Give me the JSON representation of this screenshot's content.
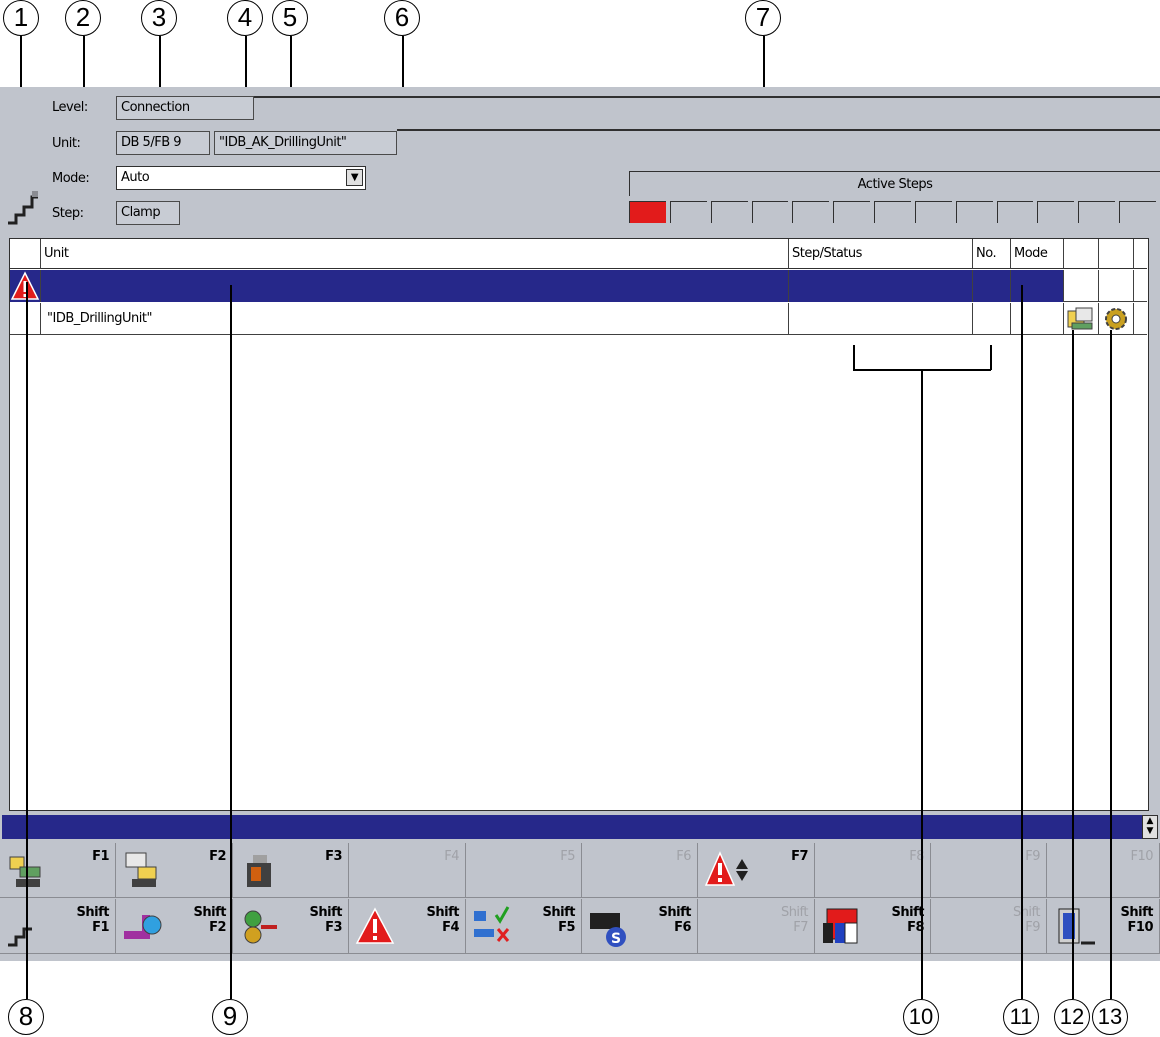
{
  "callouts": [
    "1",
    "2",
    "3",
    "4",
    "5",
    "6",
    "7",
    "8",
    "9",
    "10",
    "11",
    "12",
    "13"
  ],
  "header": {
    "level_label": "Level:",
    "level_value": "Connection",
    "unit_label": "Unit:",
    "unit_db": "DB 5/FB 9",
    "unit_name": "\"IDB_AK_DrillingUnit\"",
    "mode_label": "Mode:",
    "mode_value": "Auto",
    "step_label": "Step:",
    "step_value": "Clamp",
    "active_steps_label": "Active Steps",
    "active_steps_total": 13,
    "active_steps_active": [
      1
    ]
  },
  "table": {
    "columns": [
      "Unit",
      "Step/Status",
      "No.",
      "Mode"
    ],
    "rows": [
      {
        "unit": "",
        "step_status": "",
        "no": "",
        "mode": "",
        "selected": true,
        "alarm": true
      },
      {
        "unit": "\"IDB_DrillingUnit\"",
        "step_status": "",
        "no": "",
        "mode": "",
        "selected": false,
        "alarm": false
      }
    ]
  },
  "fkeys_row1": [
    {
      "label": "F1",
      "icon": "overview-icon",
      "enabled": true
    },
    {
      "label": "F2",
      "icon": "unit-view-icon",
      "enabled": true
    },
    {
      "label": "F3",
      "icon": "step-view-icon",
      "enabled": true
    },
    {
      "label": "F4",
      "icon": "",
      "enabled": false
    },
    {
      "label": "F5",
      "icon": "",
      "enabled": false
    },
    {
      "label": "F6",
      "icon": "",
      "enabled": false
    },
    {
      "label": "F7",
      "icon": "alarm-navigation-icon",
      "enabled": true
    },
    {
      "label": "F8",
      "icon": "",
      "enabled": false
    },
    {
      "label": "F9",
      "icon": "",
      "enabled": false
    },
    {
      "label": "F10",
      "icon": "",
      "enabled": false
    }
  ],
  "fkeys_row2": [
    {
      "label": "Shift\nF1",
      "icon": "step-up-icon",
      "enabled": true
    },
    {
      "label": "Shift\nF2",
      "icon": "pipe-icon",
      "enabled": true
    },
    {
      "label": "Shift\nF3",
      "icon": "transfer-icon",
      "enabled": true
    },
    {
      "label": "Shift\nF4",
      "icon": "alarm-icon",
      "enabled": true
    },
    {
      "label": "Shift\nF5",
      "icon": "network-ok-error-icon",
      "enabled": true
    },
    {
      "label": "Shift\nF6",
      "icon": "s-status-icon",
      "enabled": true
    },
    {
      "label": "Shift\nF7",
      "icon": "",
      "enabled": false
    },
    {
      "label": "Shift\nF8",
      "icon": "color-windows-icon",
      "enabled": true
    },
    {
      "label": "Shift\nF9",
      "icon": "",
      "enabled": false
    },
    {
      "label": "Shift\nF10",
      "icon": "exit-door-icon",
      "enabled": true
    }
  ],
  "colors": {
    "screen_bg": "#c0c4cc",
    "selection": "#26288a",
    "active_step": "#e21b1b"
  }
}
